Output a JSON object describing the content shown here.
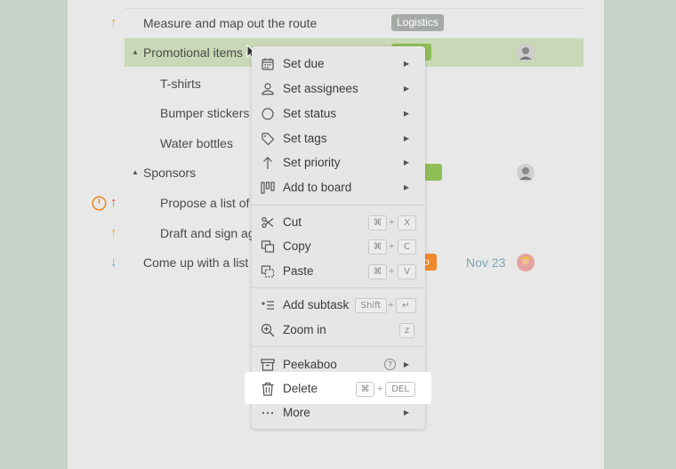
{
  "tasks": [
    {
      "title": "Measure and map out the route",
      "tag": "Logistics",
      "priority": "up"
    },
    {
      "title": "Promotional items",
      "priority": "none",
      "selected": true
    },
    {
      "title": "T-shirts"
    },
    {
      "title": "Bumper stickers"
    },
    {
      "title": "Water bottles"
    },
    {
      "title": "Sponsors"
    },
    {
      "title": "Propose a list of s",
      "priority": "up-red",
      "timer": true
    },
    {
      "title": "Draft and sign agr",
      "priority": "up"
    },
    {
      "title": "Come up with a list c",
      "tag": "o",
      "due": "Nov 23",
      "priority": "down"
    }
  ],
  "menu": {
    "items": [
      {
        "label": "Set due",
        "icon": "calendar-icon",
        "submenu": true
      },
      {
        "label": "Set assignees",
        "icon": "person-icon",
        "submenu": true
      },
      {
        "label": "Set status",
        "icon": "circle-icon",
        "submenu": true
      },
      {
        "label": "Set tags",
        "icon": "tag-icon",
        "submenu": true
      },
      {
        "label": "Set priority",
        "icon": "arrow-up-icon",
        "submenu": true
      },
      {
        "label": "Add to board",
        "icon": "board-icon",
        "submenu": true
      },
      {
        "label": "Cut",
        "icon": "scissors-icon",
        "shortcut": [
          "⌘",
          "+",
          "X"
        ]
      },
      {
        "label": "Copy",
        "icon": "copy-icon",
        "shortcut": [
          "⌘",
          "+",
          "C"
        ]
      },
      {
        "label": "Paste",
        "icon": "paste-icon",
        "shortcut": [
          "⌘",
          "+",
          "V"
        ]
      },
      {
        "label": "Add subtask",
        "icon": "add-subtask-icon",
        "shortcut": [
          "Shift",
          "+",
          "↵"
        ]
      },
      {
        "label": "Zoom in",
        "icon": "zoom-in-icon",
        "shortcut": [
          "z"
        ]
      },
      {
        "label": "Peekaboo",
        "icon": "archive-icon",
        "submenu": true,
        "help": "?"
      },
      {
        "label": "Delete",
        "icon": "trash-icon",
        "shortcut": [
          "⌘",
          "+",
          "DEL"
        ],
        "highlighted": true
      },
      {
        "label": "More",
        "icon": "more-icon",
        "submenu": true
      }
    ],
    "submenu_glyph": "▶"
  },
  "colors": {
    "logistics_tag": "#a6aaa7",
    "green_tag": "#8fbe58",
    "orange_tag": "#ee8a2c",
    "priority_up": "#e8a92a",
    "priority_red": "#e44d3a",
    "priority_down": "#7aa9c0",
    "due_text": "#7aa5b2",
    "selected_row": "#c9d8b6"
  }
}
